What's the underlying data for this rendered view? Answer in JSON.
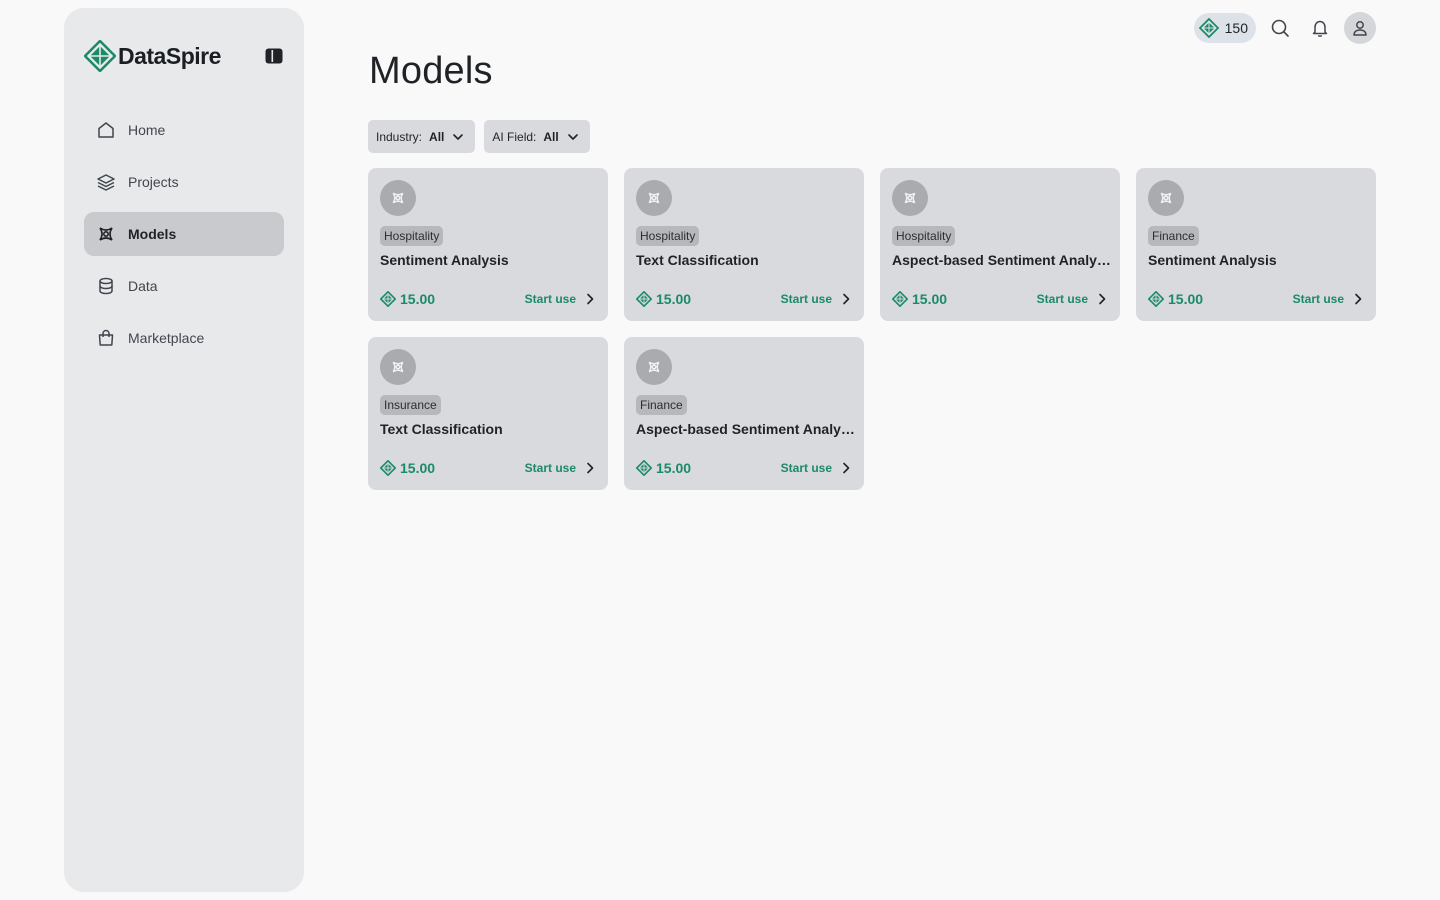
{
  "brand": {
    "name": "DataSpire",
    "color": "#1a8a68"
  },
  "nav": [
    {
      "label": "Home",
      "icon": "home-icon",
      "active": false
    },
    {
      "label": "Projects",
      "icon": "layers-icon",
      "active": false
    },
    {
      "label": "Models",
      "icon": "model-icon",
      "active": true
    },
    {
      "label": "Data",
      "icon": "database-icon",
      "active": false
    },
    {
      "label": "Marketplace",
      "icon": "shopping-bag-icon",
      "active": false
    }
  ],
  "topbar": {
    "credits": "150"
  },
  "page": {
    "title": "Models"
  },
  "filters": [
    {
      "label": "Industry:",
      "value": "All"
    },
    {
      "label": "AI Field:",
      "value": "All"
    }
  ],
  "cards": [
    {
      "tag": "Hospitality",
      "title": "Sentiment Analysis",
      "price": "15.00",
      "action": "Start use"
    },
    {
      "tag": "Hospitality",
      "title": "Text Classification",
      "price": "15.00",
      "action": "Start use"
    },
    {
      "tag": "Hospitality",
      "title": "Aspect-based Sentiment Analysis",
      "price": "15.00",
      "action": "Start use"
    },
    {
      "tag": "Finance",
      "title": "Sentiment Analysis",
      "price": "15.00",
      "action": "Start use"
    },
    {
      "tag": "Insurance",
      "title": "Text Classification",
      "price": "15.00",
      "action": "Start use"
    },
    {
      "tag": "Finance",
      "title": "Aspect-based Sentiment Analysis",
      "price": "15.00",
      "action": "Start use"
    }
  ]
}
